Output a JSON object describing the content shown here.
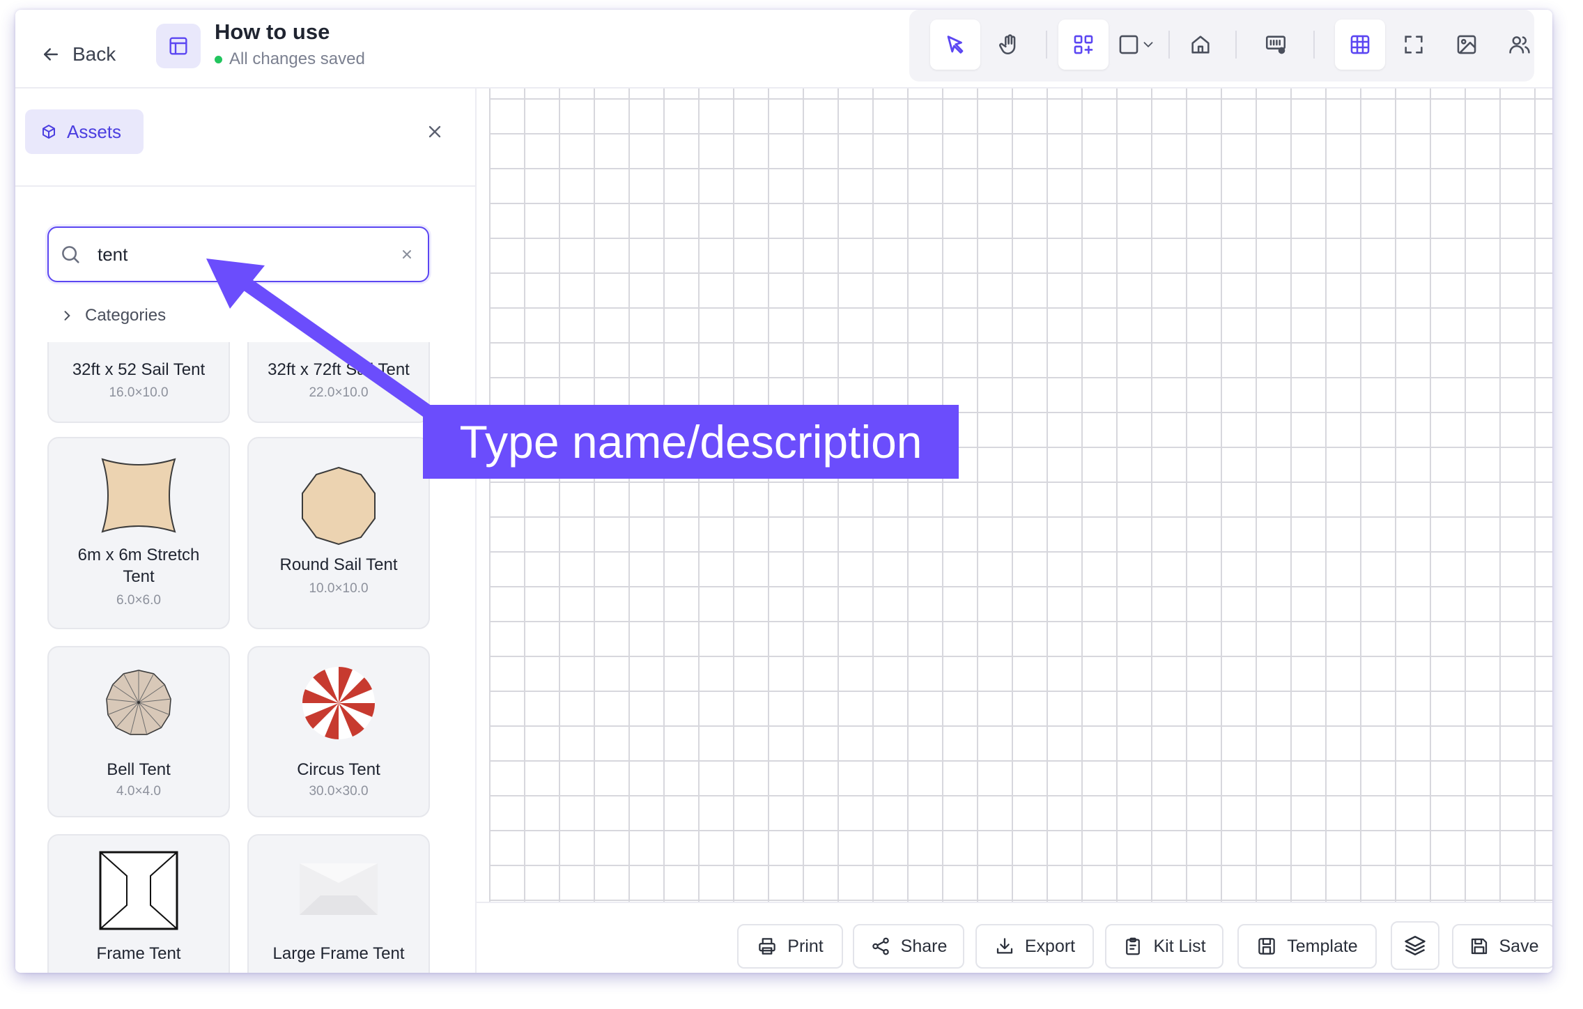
{
  "header": {
    "back_label": "Back",
    "title": "How to use",
    "status": "All changes saved"
  },
  "toolbar": {
    "tools": [
      "select-icon",
      "hand-icon",
      "add-elements-icon",
      "shape-icon",
      "home-icon",
      "layout-icon",
      "grid-icon",
      "fullscreen-icon",
      "image-icon",
      "users-icon"
    ],
    "accent": "#5b46f2"
  },
  "panel": {
    "tab_label": "Assets",
    "search": {
      "value": "tent",
      "placeholder": ""
    },
    "categories_label": "Categories",
    "items": [
      {
        "name": "32ft x 52 Sail Tent",
        "dims": "16.0×10.0"
      },
      {
        "name": "32ft x 72ft Sail Tent",
        "dims": "22.0×10.0"
      },
      {
        "name": "6m x 6m Stretch Tent",
        "dims": "6.0×6.0"
      },
      {
        "name": "Round Sail Tent",
        "dims": "10.0×10.0"
      },
      {
        "name": "Bell Tent",
        "dims": "4.0×4.0"
      },
      {
        "name": "Circus Tent",
        "dims": "30.0×30.0"
      },
      {
        "name": "Frame Tent",
        "dims": ""
      },
      {
        "name": "Large Frame Tent",
        "dims": ""
      }
    ]
  },
  "bottom_bar": {
    "print": "Print",
    "share": "Share",
    "export": "Export",
    "kit_list": "Kit List",
    "template": "Template",
    "save": "Save"
  },
  "callout": {
    "label": "Type name/description",
    "color": "#6b4dfc"
  }
}
